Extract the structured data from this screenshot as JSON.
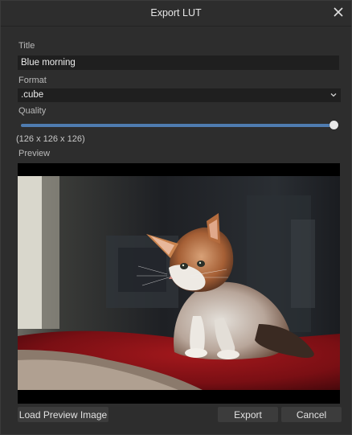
{
  "window": {
    "title": "Export LUT",
    "close_icon": "close-icon"
  },
  "form": {
    "title_label": "Title",
    "title_value": "Blue morning",
    "format_label": "Format",
    "format_value": ".cube",
    "quality_label": "Quality",
    "quality_level": 1.0,
    "dimensions_text": "(126 x 126 x 126)",
    "preview_label": "Preview"
  },
  "preview": {
    "subject": "kitten-photo"
  },
  "buttons": {
    "load_preview": "Load Preview Image",
    "export": "Export",
    "cancel": "Cancel"
  },
  "colors": {
    "background": "#2d2d2d",
    "field_background": "#1f1f1f",
    "accent": "#4f7cb0",
    "button": "#3c3c3c"
  }
}
